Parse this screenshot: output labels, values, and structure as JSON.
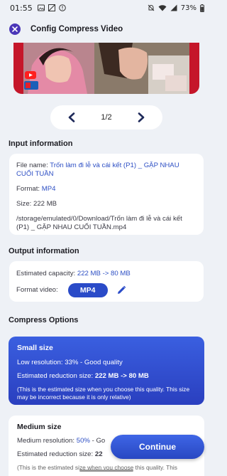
{
  "status": {
    "time": "01:55",
    "battery": "73%"
  },
  "header": {
    "title": "Config Compress Video"
  },
  "pager": {
    "current": "1/2"
  },
  "input_info": {
    "heading": "Input information",
    "file_name_label": "File name:",
    "file_name_value": "Trốn làm đi lễ và cái kết (P1) _ GẶP NHAU CUỐI TUẦN",
    "format_label": "Format:",
    "format_value": "MP4",
    "size_label": "Size:",
    "size_value": "222 MB",
    "path": "/storage/emulated/0/Download/Trốn làm đi lễ và cái kết (P1) _ GẶP NHAU CUỐI TUẦN.mp4"
  },
  "output_info": {
    "heading": "Output information",
    "capacity_label": "Estimated capacity:",
    "capacity_value": "222 MB -> 80 MB",
    "format_label": "Format video:",
    "format_value": "MP4"
  },
  "compress": {
    "heading": "Compress Options",
    "options": [
      {
        "title": "Small size",
        "resolution_text": "Low resolution: 33% - Good quality",
        "reduction_label": "Estimated reduction size:",
        "reduction_value": "222 MB -> 80 MB",
        "note": "(This is the estimated size when you choose this quality. This size may be incorrect because it is only relative)",
        "selected": true
      },
      {
        "title": "Medium size",
        "resolution_label": "Medium resolution:",
        "resolution_value": "50%",
        "resolution_rest": "- Go",
        "reduction_label": "Estimated reduction size:",
        "reduction_value": "22",
        "note": "(This is the estimated size when you choose this quality. This",
        "selected": false
      }
    ]
  },
  "continue_label": "Continue",
  "colors": {
    "accent": "#2a4bc8",
    "close": "#4a36b8",
    "background": "#eef1f6"
  }
}
